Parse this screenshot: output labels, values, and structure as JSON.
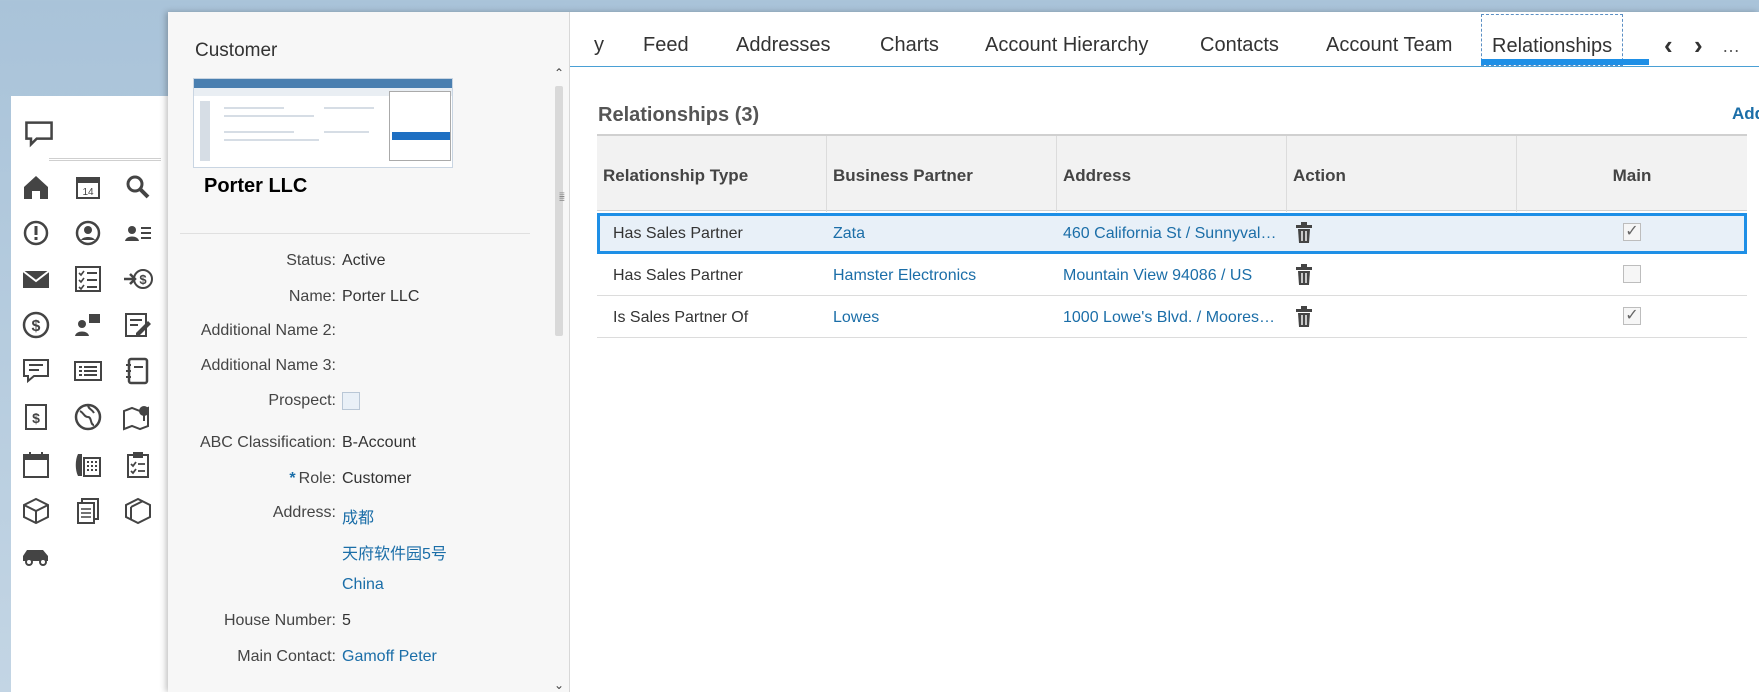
{
  "detail": {
    "object_type": "Customer",
    "object_name": "Porter LLC",
    "fields": [
      {
        "label": "Status:",
        "value": "Active"
      },
      {
        "label": "Name:",
        "value": "Porter LLC"
      },
      {
        "label": "Additional Name 2:",
        "value": ""
      },
      {
        "label": "Additional Name 3:",
        "value": ""
      },
      {
        "label": "Prospect:",
        "value": ""
      },
      {
        "label": "ABC Classification:",
        "value": "B-Account"
      },
      {
        "label": "Role:",
        "value": "Customer"
      },
      {
        "label": "Address:",
        "value": "成都"
      },
      {
        "label": "",
        "value": "天府软件园5号"
      },
      {
        "label": "",
        "value": "China"
      },
      {
        "label": "House Number:",
        "value": "5"
      },
      {
        "label": "Main Contact:",
        "value": "Gamoff Peter"
      }
    ],
    "required_marker": "*"
  },
  "tabs": {
    "partial": "y",
    "items": [
      "Feed",
      "Addresses",
      "Charts",
      "Account Hierarchy",
      "Contacts",
      "Account Team",
      "Relationships"
    ],
    "active": "Relationships",
    "prev": "‹",
    "next": "›",
    "more": "…"
  },
  "relationships": {
    "title": "Relationships (3)",
    "add_label": "Add",
    "columns": [
      "Relationship Type",
      "Business Partner",
      "Address",
      "Action",
      "Main"
    ],
    "rows": [
      {
        "type": "Has Sales Partner",
        "partner": "Zata",
        "address": "460 California St / Sunnyvale…",
        "main": true,
        "selected": true
      },
      {
        "type": "Has Sales Partner",
        "partner": "Hamster Electronics",
        "address": "Mountain View 94086 / US",
        "main": false,
        "selected": false
      },
      {
        "type": "Is Sales Partner Of",
        "partner": "Lowes",
        "address": "1000 Lowe's Blvd. / Mooresvi…",
        "main": true,
        "selected": false
      }
    ]
  },
  "colors": {
    "accent": "#1e8fe6",
    "link": "#1b6ea8",
    "selected_row_bg": "#e8f0f8"
  },
  "rail_icons": [
    "chat-icon",
    "home-icon",
    "calendar-icon",
    "search-icon",
    "alert-icon",
    "account-icon",
    "contacts-list-icon",
    "mail-icon",
    "task-list-icon",
    "sales-icon",
    "dollar-icon",
    "people-chart-icon",
    "report-icon",
    "quote-icon",
    "list-card-icon",
    "notebook-icon",
    "invoice-icon",
    "globe-icon",
    "map-icon",
    "appointment-icon",
    "phone-icon",
    "clipboard-icon",
    "box-icon",
    "documents-icon",
    "package-icon",
    "car-icon"
  ]
}
